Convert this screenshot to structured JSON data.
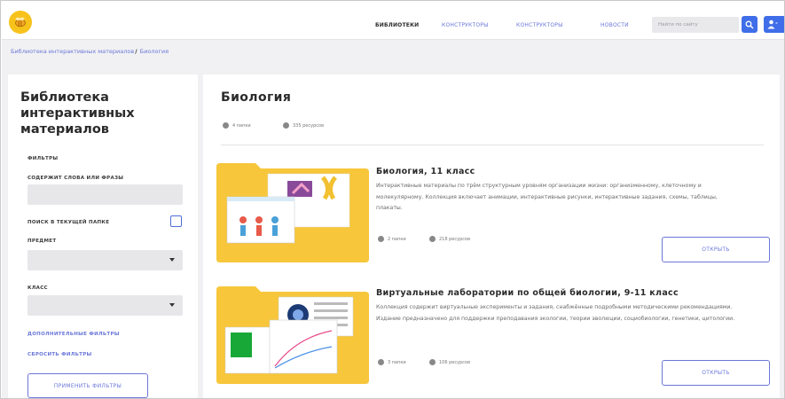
{
  "header": {
    "nav": [
      {
        "label": "Библиотеки",
        "active": true
      },
      {
        "label": "Конструкторы",
        "active": false
      },
      {
        "label": "Конструкторы",
        "active": false
      },
      {
        "label": "Новости",
        "active": false
      }
    ],
    "search_placeholder": "Найти по сайту",
    "icons": {
      "logo": "bee-logo-icon",
      "search": "search-icon",
      "user": "user-icon"
    },
    "accent": "#3f6ee8",
    "link_color": "#6a77d8"
  },
  "breadcrumb": {
    "items": [
      "Библиотека интерактивных материалов",
      "Биология"
    ],
    "separator": "/"
  },
  "filters": {
    "title": "Библиотека интерактивных материалов",
    "section_label": "Фильтры",
    "contains_label": "Содержит слова или фразы",
    "contains_value": "",
    "current_folder_label": "Поиск в текущей папке",
    "current_folder_checked": false,
    "subject_label": "Предмет",
    "subject_value": "",
    "class_label": "Класс",
    "class_value": "",
    "more_filters": "Дополнительные фильтры",
    "reset_filters": "Сбросить фильтры",
    "apply_filters": "Применить фильтры"
  },
  "main": {
    "title": "Биология",
    "folders_count": "4 папки",
    "resources_count": "335 ресурсов",
    "cards": [
      {
        "title": "Биология, 11 класс",
        "description": "Интерактивные материалы по трём структурным уровням организации жизни: организменному, клеточному и молекулярному. Коллекция включает анимации, интерактивные рисунки, интерактивные задания, схемы, таблицы, плакаты.",
        "folders": "2 папки",
        "resources": "218 ресурсов",
        "open_label": "Открыть"
      },
      {
        "title": "Виртуальные лаборатории по общей биологии, 9-11 класс",
        "description": "Коллекция содержит виртуальные эксперименты и задания, снабжённые подробными методическими рекомендациями. Издание предназначено для поддержки преподавания экологии, теории эволюции, социобиологии, генетики, цитологии.",
        "folders": "3 папки",
        "resources": "106 ресурсов",
        "open_label": "Открыть"
      }
    ]
  }
}
